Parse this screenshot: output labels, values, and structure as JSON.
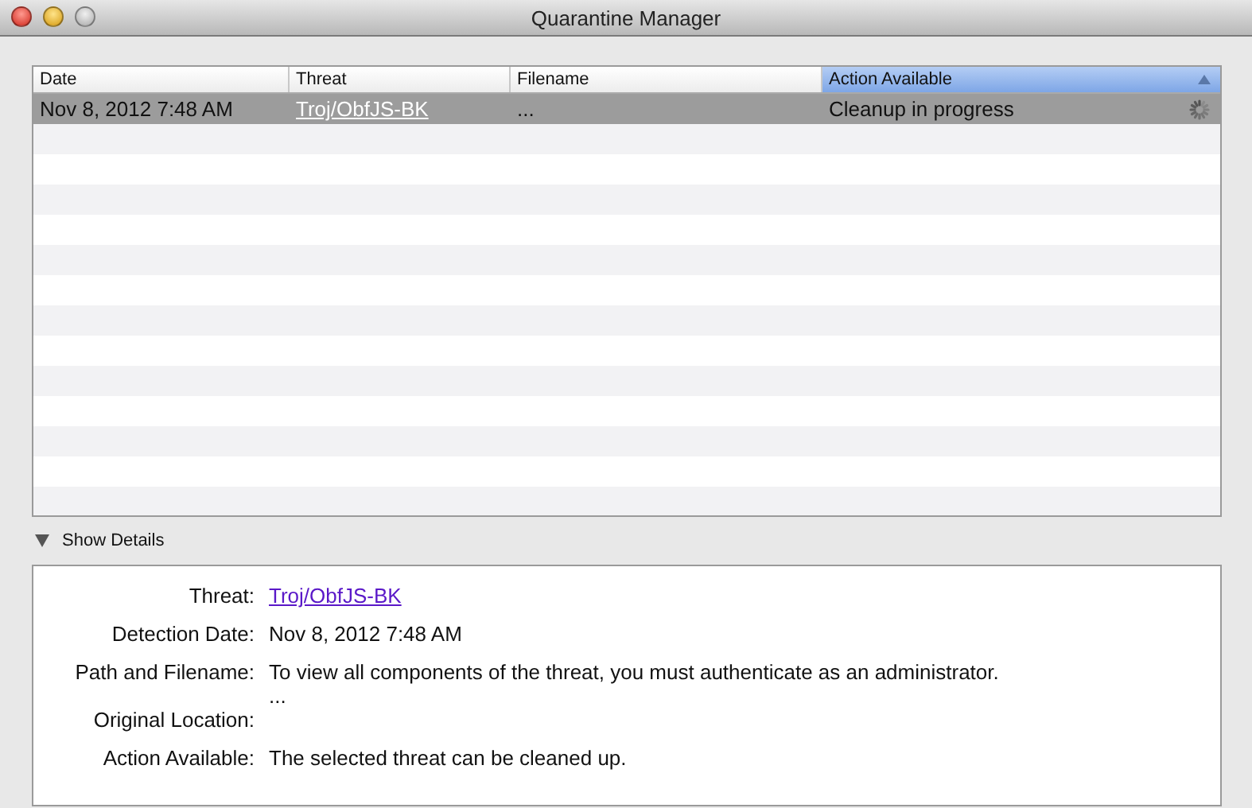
{
  "window": {
    "title": "Quarantine Manager"
  },
  "table": {
    "columns": [
      {
        "label": "Date",
        "selected": false
      },
      {
        "label": "Threat",
        "selected": false
      },
      {
        "label": "Filename",
        "selected": false
      },
      {
        "label": "Action Available",
        "selected": true
      }
    ],
    "rows": [
      {
        "date": "Nov 8, 2012 7:48 AM",
        "threat": "Troj/ObfJS-BK",
        "filename": "...",
        "action": "Cleanup in progress",
        "busy": true,
        "selected": true
      }
    ]
  },
  "details": {
    "toggle": {
      "label": "Show Details",
      "expanded": true
    },
    "fields": [
      {
        "label": "Threat:",
        "kind": "link",
        "lines": [
          "Troj/ObfJS-BK"
        ]
      },
      {
        "label": "Detection Date:",
        "kind": "text",
        "lines": [
          "Nov 8, 2012 7:48 AM"
        ]
      },
      {
        "label": "Path and Filename:",
        "kind": "text",
        "lines": [
          "To view all components of the threat, you must authenticate as an administrator.",
          "..."
        ]
      },
      {
        "label": "Original Location:"
      },
      {
        "label": "Action Available:",
        "kind": "text",
        "lines": [
          "The selected threat can be cleaned up."
        ]
      }
    ]
  }
}
